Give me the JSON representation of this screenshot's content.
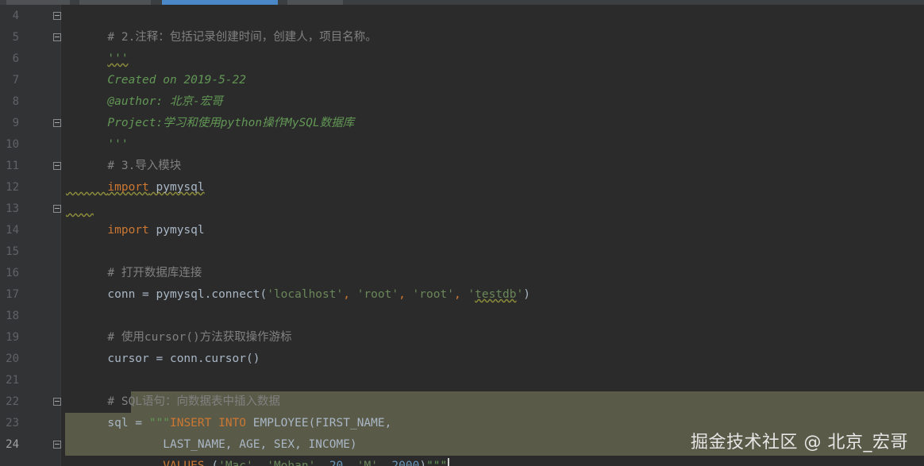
{
  "editor": {
    "lines": [
      {
        "num": "4",
        "text": "# 2.注释：包括记录创建时间，创建人，项目名称。"
      },
      {
        "num": "5",
        "text": "'''"
      },
      {
        "num": "6",
        "text": "Created on 2019-5-22"
      },
      {
        "num": "7",
        "text": "@author: 北京-宏哥"
      },
      {
        "num": "8",
        "text": "Project:学习和使用python操作MySQL数据库"
      },
      {
        "num": "9",
        "text": "'''"
      },
      {
        "num": "10",
        "text": "# 3.导入模块"
      },
      {
        "num": "11",
        "kw": "import",
        "rest": " pymysql"
      },
      {
        "num": "12",
        "text": ""
      },
      {
        "num": "13",
        "kw": "import",
        "rest": " pymysql"
      },
      {
        "num": "14",
        "text": ""
      },
      {
        "num": "15",
        "text": "# 打开数据库连接"
      },
      {
        "num": "16",
        "prefix": "conn = pymysql.connect(",
        "s1": "'localhost'",
        "c1": ", ",
        "s2": "'root'",
        "c2": ", ",
        "s3": "'root'",
        "c3": ", ",
        "s4a": "'",
        "s4b": "testdb",
        "s4c": "'",
        "suffix": ")"
      },
      {
        "num": "17",
        "text": ""
      },
      {
        "num": "18",
        "text": "# 使用cursor()方法获取操作游标"
      },
      {
        "num": "19",
        "text": "cursor = conn.cursor()"
      },
      {
        "num": "20",
        "text": ""
      },
      {
        "num": "21",
        "text": "# SQL语句：向数据表中插入数据"
      },
      {
        "num": "22",
        "prefix": "sql = ",
        "q": "\"\"\"",
        "k1": "INSERT",
        "sp": " ",
        "k2": "INTO",
        "rest": " EMPLOYEE(FIRST_NAME,"
      },
      {
        "num": "23",
        "indent": "        ",
        "text": "LAST_NAME, AGE, SEX, INCOME)"
      },
      {
        "num": "24",
        "indent": "        ",
        "k1": "VALUES",
        "p1": " (",
        "s1": "'Mac'",
        "c1": ", ",
        "s2a": "'",
        "s2b": "Mohan",
        "s2c": "'",
        "c2": ", ",
        "n1": "20",
        "c3": ", ",
        "s3": "'M'",
        "c4": ", ",
        "n2": "2000",
        "p2": ")",
        "q": "\"\"\""
      }
    ]
  },
  "watermark": "掘金技术社区 @ 北京_宏哥"
}
